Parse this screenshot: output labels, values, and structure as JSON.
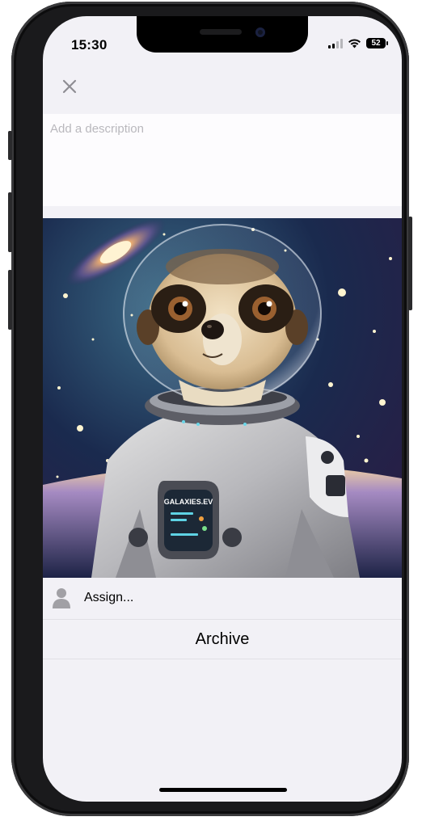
{
  "status_bar": {
    "time": "15:30",
    "battery_level": "52",
    "signal_icon": "cellular-signal-icon",
    "wifi_icon": "wifi-icon",
    "battery_icon": "battery-icon"
  },
  "header": {
    "close_icon": "close-icon"
  },
  "description": {
    "placeholder": "Add a description",
    "value": ""
  },
  "photo": {
    "subject": "meerkat astronaut",
    "panel_text": "GALAXIES.EV"
  },
  "assign": {
    "icon": "person-icon",
    "label": "Assign..."
  },
  "archive": {
    "label": "Archive"
  },
  "colors": {
    "screen_background": "#f2f1f6",
    "description_background": "#fdfcfe",
    "placeholder": "#b9b8bd",
    "icon_gray": "#a1a0a5"
  }
}
